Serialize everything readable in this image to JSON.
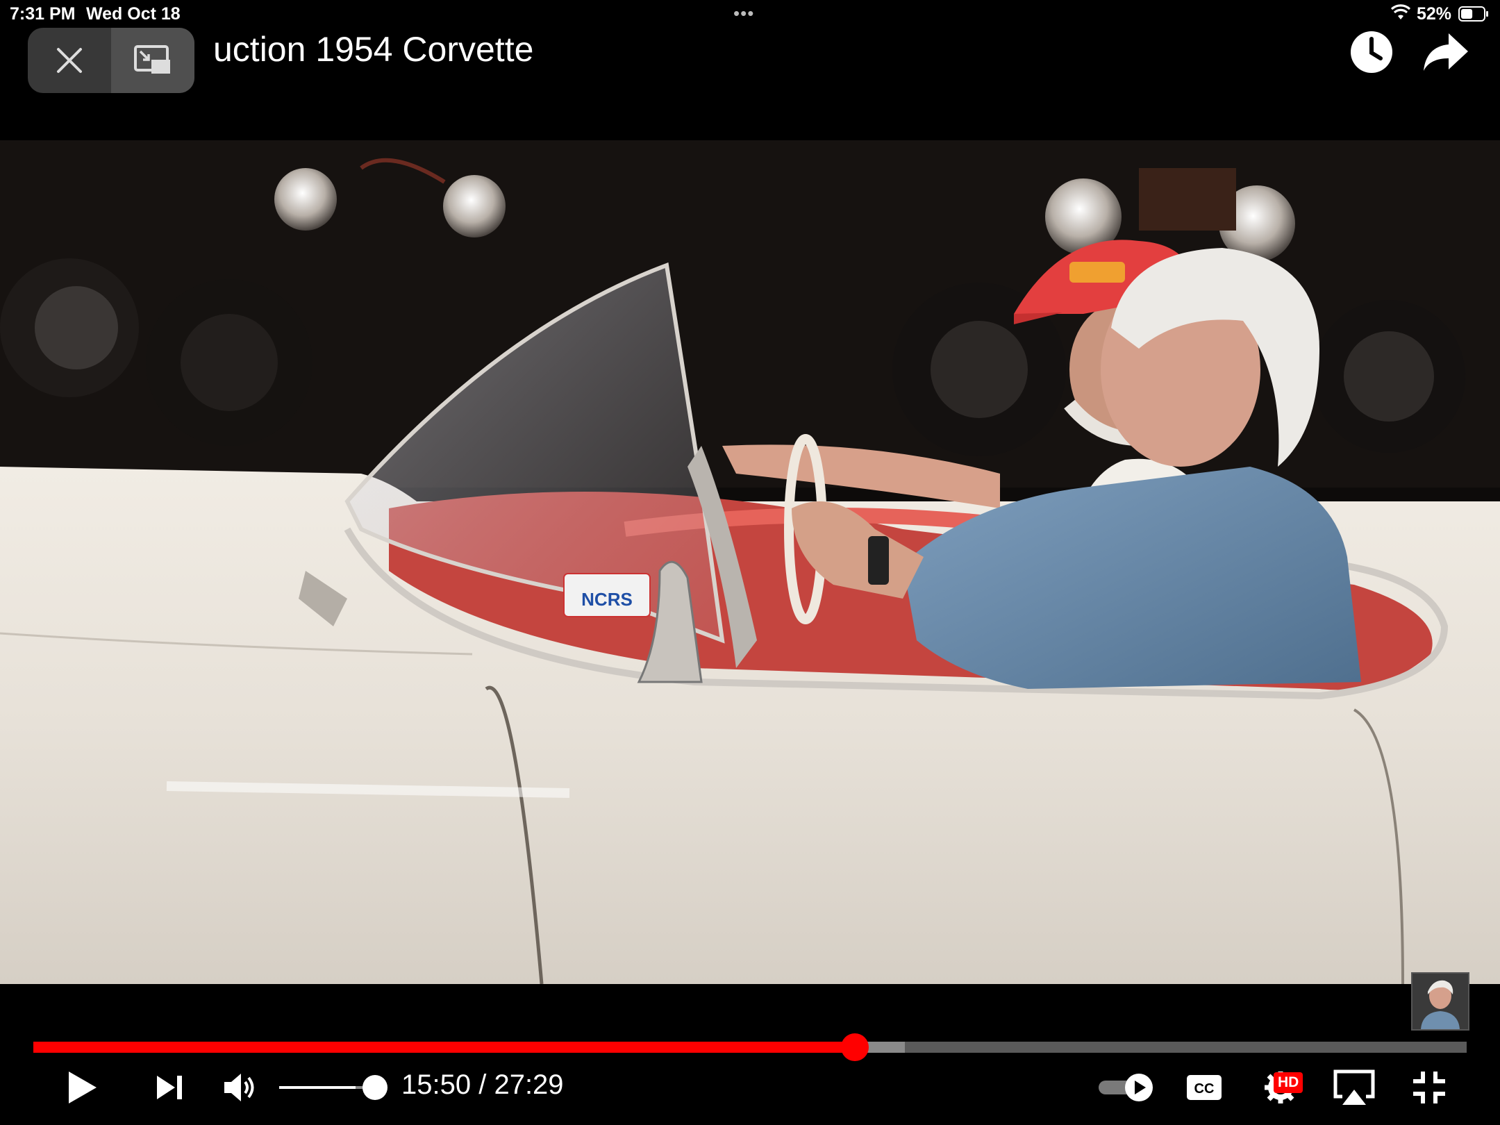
{
  "status_bar": {
    "time": "7:31 PM",
    "date": "Wed Oct 18",
    "multitask_dots": "•••",
    "battery_percent": "52%",
    "battery_level": 0.52
  },
  "video": {
    "title_visible": "uction 1954 Corvette",
    "current_time": "15:50",
    "separator": " / ",
    "duration": "27:29",
    "played_fraction": 0.573,
    "buffered_fraction": 0.608,
    "volume_level": 0.8,
    "sticker_text": "NCRS",
    "hd_badge": "HD",
    "cc_label": "CC"
  },
  "icons": {
    "pip_close": "close-icon",
    "pip_restore": "pip-restore-icon",
    "watch_later": "clock-icon",
    "share": "share-icon",
    "play": "play-icon",
    "next": "next-icon",
    "volume": "volume-icon",
    "autoplay": "autoplay-toggle",
    "captions": "captions-icon",
    "settings": "settings-icon",
    "airplay": "airplay-icon",
    "exit_fullscreen": "exit-fullscreen-icon"
  },
  "colors": {
    "progress_played": "#ff0000",
    "progress_buffered": "#8a8a8a",
    "progress_track": "#5a5a5a"
  }
}
